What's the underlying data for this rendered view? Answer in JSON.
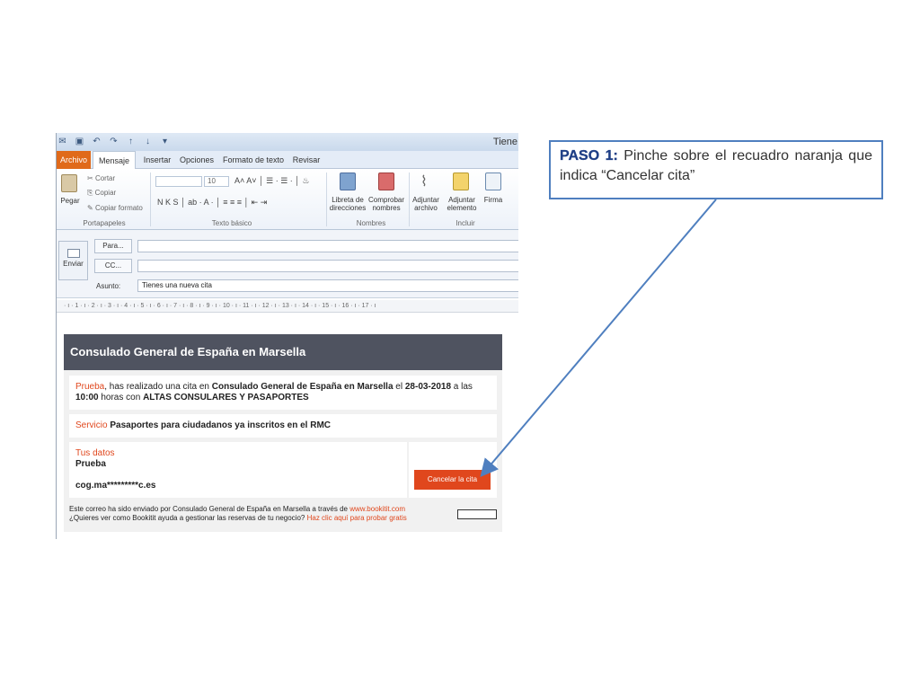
{
  "window": {
    "title": "Tiene",
    "tabs": [
      "Archivo",
      "Mensaje",
      "Insertar",
      "Opciones",
      "Formato de texto",
      "Revisar"
    ],
    "active_tab": "Mensaje"
  },
  "ribbon": {
    "pegar": "Pegar",
    "cortar": "Cortar",
    "copiar": "Copiar",
    "copiar_formato": "Copiar formato",
    "font_size": "10",
    "libreta": "Libreta de\ndirecciones",
    "comprobar": "Comprobar\nnombres",
    "adjuntar_archivo": "Adjuntar\narchivo",
    "adjuntar_elemento": "Adjuntar\nelemento",
    "firma": "Firma",
    "groups": [
      "Portapapeles",
      "Texto básico",
      "Nombres",
      "Incluir"
    ]
  },
  "compose": {
    "send": "Enviar",
    "to": "Para...",
    "cc": "CC...",
    "subject_label": "Asunto:",
    "subject_value": "Tienes una nueva cita",
    "ruler": "· ı · 1 · ı · 2 · ı · 3 · ı · 4 · ı · 5 · ı · 6 · ı · 7 · ı · 8 · ı · 9 · ı · 10 · ı · 11 · ı · 12 · ı · 13 · ı · 14 · ı · 15 · ı · 16 · ı · 17 · ı"
  },
  "email": {
    "header": "Consulado General de España en Marsella",
    "name": "Prueba",
    "line1_a": ", has realizado una cita en ",
    "consulate": "Consulado General de España en Marsella",
    "line1_b": " el ",
    "date": "28-03-2018",
    "line1_c": " a las",
    "time": "10:00",
    "line2_a": " horas con ",
    "service_name": "ALTAS CONSULARES Y PASAPORTES",
    "servicio_label": "Servicio",
    "servicio_value": "Pasaportes para ciudadanos ya inscritos en el RMC",
    "tus_datos": "Tus datos",
    "datos_name": "Prueba",
    "datos_email": "cog.ma*********c.es",
    "cancel_button": "Cancelar la cita",
    "footer_1a": "Este correo ha sido enviado por Consulado General de España en Marsella a través de ",
    "footer_1b": "www.bookitit.com",
    "footer_2a": "¿Quieres ver como Bookitit ayuda a gestionar las reservas de tu negocio? ",
    "footer_2b": "Haz clic aquí para probar gratis"
  },
  "annotation": {
    "step": "PASO 1:",
    "text": " Pinche sobre el recuadro naranja que indica “Cancelar cita”",
    "border_color": "#4f7fbf"
  },
  "colors": {
    "accent_orange": "#e0471d",
    "header_gray": "#4f5360"
  }
}
